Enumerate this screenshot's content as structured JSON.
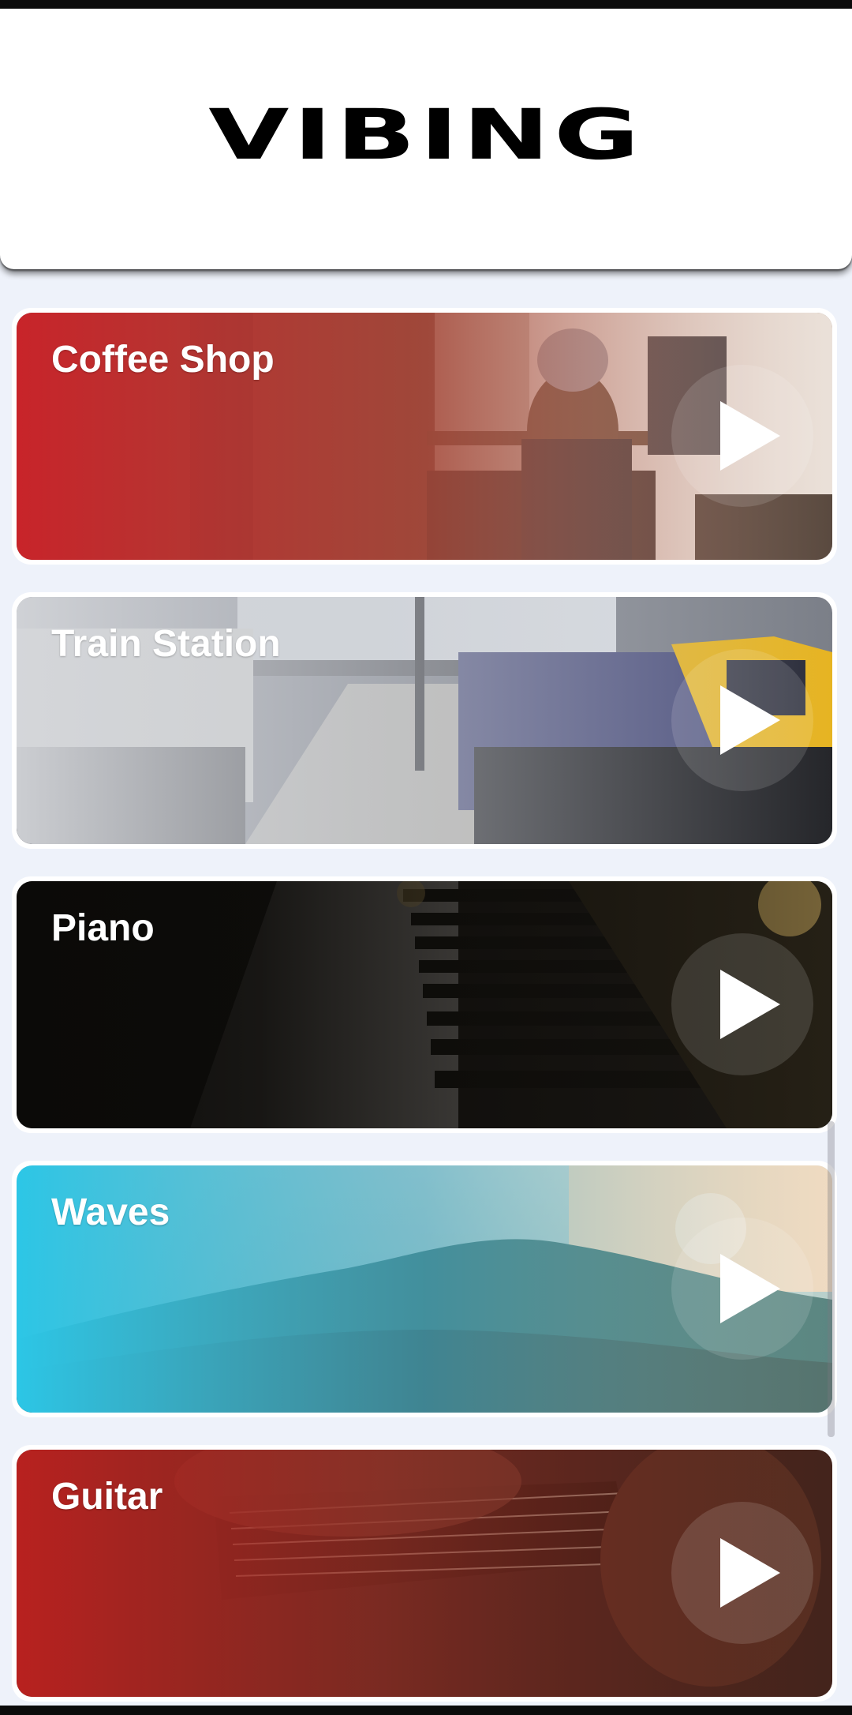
{
  "app": {
    "logo_text": "VIBING"
  },
  "sounds": [
    {
      "title": "Coffee Shop",
      "icon": "play-icon"
    },
    {
      "title": "Train Station",
      "icon": "play-icon"
    },
    {
      "title": "Piano",
      "icon": "play-icon"
    },
    {
      "title": "Waves",
      "icon": "play-icon"
    },
    {
      "title": "Guitar",
      "icon": "play-icon"
    }
  ],
  "colors": {
    "coffee_tint": "#c8242a",
    "train_tint": "#c9ccd2",
    "piano_tint": "#0b0a08",
    "waves_tint": "#2cc6e6",
    "guitar_tint": "#b8211f",
    "background": "#eef2fa"
  }
}
